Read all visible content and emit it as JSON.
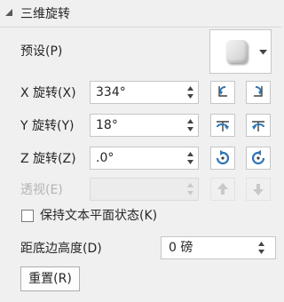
{
  "panel": {
    "section_title": "三维旋转",
    "preset_label": "预设(P)",
    "x_rotation": {
      "label": "X 旋转(X)",
      "value": "334°"
    },
    "y_rotation": {
      "label": "Y 旋转(Y)",
      "value": "18°"
    },
    "z_rotation": {
      "label": "Z 旋转(Z)",
      "value": ".0°"
    },
    "perspective": {
      "label": "透视(E)",
      "value": "",
      "enabled": false
    },
    "keep_text_flat": {
      "label": "保持文本平面状态(K)",
      "checked": false
    },
    "distance_from_ground": {
      "label": "距底边高度(D)",
      "value": "0 磅"
    },
    "reset_label": "重置(R)"
  },
  "colors": {
    "accent": "#c0504d",
    "icon_blue": "#2e75b6",
    "disabled_icon": "#c8c8c8"
  },
  "icons": {
    "x_left": "rotate-left-x-icon",
    "x_right": "rotate-right-x-icon",
    "y_up": "rotate-up-y-icon",
    "y_down": "rotate-down-y-icon",
    "z_ccw": "rotate-counterclockwise-z-icon",
    "z_cw": "rotate-clockwise-z-icon",
    "p_increase": "increase-perspective-icon",
    "p_decrease": "decrease-perspective-icon"
  }
}
